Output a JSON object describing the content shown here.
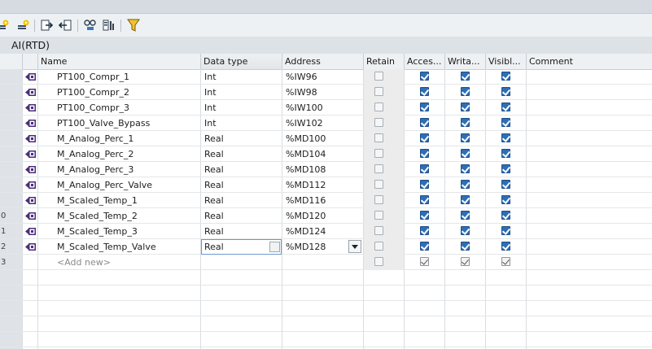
{
  "table_title": "AI(RTD)",
  "columns": {
    "name": "Name",
    "data_type": "Data type",
    "address": "Address",
    "retain": "Retain",
    "accessible": "Acces...",
    "writable": "Writa...",
    "visible": "Visibl...",
    "comment": "Comment"
  },
  "rows": [
    {
      "num": "",
      "name": "PT100_Compr_1",
      "data_type": "Int",
      "address": "%IW96",
      "retain": false,
      "accessible": true,
      "writable": true,
      "visible": true
    },
    {
      "num": "",
      "name": "PT100_Compr_2",
      "data_type": "Int",
      "address": "%IW98",
      "retain": false,
      "accessible": true,
      "writable": true,
      "visible": true
    },
    {
      "num": "",
      "name": "PT100_Compr_3",
      "data_type": "Int",
      "address": "%IW100",
      "retain": false,
      "accessible": true,
      "writable": true,
      "visible": true
    },
    {
      "num": "",
      "name": "PT100_Valve_Bypass",
      "data_type": "Int",
      "address": "%IW102",
      "retain": false,
      "accessible": true,
      "writable": true,
      "visible": true
    },
    {
      "num": "",
      "name": "M_Analog_Perc_1",
      "data_type": "Real",
      "address": "%MD100",
      "retain": false,
      "accessible": true,
      "writable": true,
      "visible": true
    },
    {
      "num": "",
      "name": "M_Analog_Perc_2",
      "data_type": "Real",
      "address": "%MD104",
      "retain": false,
      "accessible": true,
      "writable": true,
      "visible": true
    },
    {
      "num": "",
      "name": "M_Analog_Perc_3",
      "data_type": "Real",
      "address": "%MD108",
      "retain": false,
      "accessible": true,
      "writable": true,
      "visible": true
    },
    {
      "num": "",
      "name": "M_Analog_Perc_Valve",
      "data_type": "Real",
      "address": "%MD112",
      "retain": false,
      "accessible": true,
      "writable": true,
      "visible": true
    },
    {
      "num": "",
      "name": "M_Scaled_Temp_1",
      "data_type": "Real",
      "address": "%MD116",
      "retain": false,
      "accessible": true,
      "writable": true,
      "visible": true
    },
    {
      "num": "0",
      "name": "M_Scaled_Temp_2",
      "data_type": "Real",
      "address": "%MD120",
      "retain": false,
      "accessible": true,
      "writable": true,
      "visible": true
    },
    {
      "num": "1",
      "name": "M_Scaled_Temp_3",
      "data_type": "Real",
      "address": "%MD124",
      "retain": false,
      "accessible": true,
      "writable": true,
      "visible": true
    },
    {
      "num": "2",
      "name": "M_Scaled_Temp_Valve",
      "data_type": "Real",
      "address": "%MD128",
      "retain": false,
      "accessible": true,
      "writable": true,
      "visible": true
    }
  ],
  "add_row": {
    "num": "3",
    "label": "<Add new>"
  },
  "icons": {
    "toolbar": [
      "add-tag-icon",
      "insert-tag-icon",
      "export-icon",
      "import-icon",
      "monitor-icon",
      "settings-icon",
      "filter-icon"
    ],
    "row": "tag-icon"
  },
  "colors": {
    "accent": "#2d6fb7",
    "header_bg": "#dde2e6",
    "filter": "#e7b51c"
  }
}
